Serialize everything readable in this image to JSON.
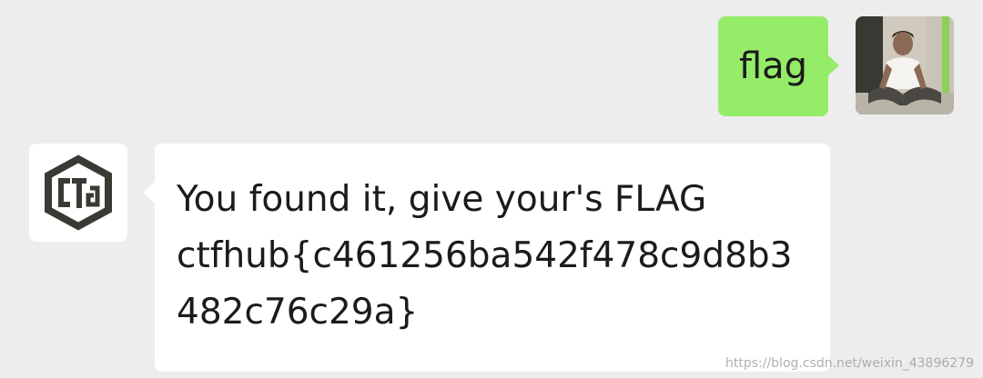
{
  "conversation": {
    "outgoing": {
      "text": "flag",
      "avatar": "user-photo-avatar"
    },
    "incoming": {
      "avatar": "ctfhub-logo-avatar",
      "lines": [
        "You found it, give your's FLAG",
        "ctfhub{c461256ba542f478c9d8b3",
        "482c76c29a}"
      ]
    }
  },
  "watermark": "https://blog.csdn.net/weixin_43896279",
  "colors": {
    "background": "#ededed",
    "outgoing_bubble": "#95ec69",
    "incoming_bubble": "#ffffff",
    "text": "#1b1b1b"
  }
}
